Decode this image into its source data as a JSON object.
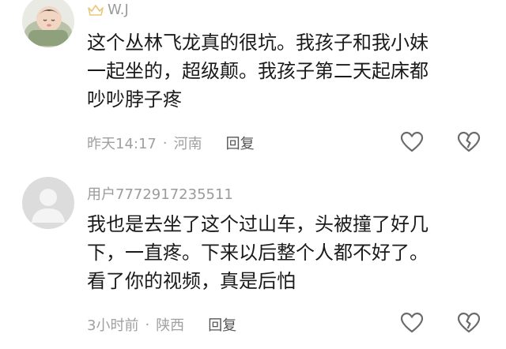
{
  "comments": [
    {
      "username": "W.J",
      "has_crown_badge": true,
      "avatar_icon": "baby-sleeping-avatar",
      "text_lines": [
        "这个丛林飞龙真的很坑。我孩子和我小妹",
        "一起坐的，超级颠。我孩子第二天起床都",
        "吵吵脖子疼"
      ],
      "time": "昨天14:17",
      "separator": "·",
      "location": "河南",
      "reply_label": "回复",
      "like_icon": "heart-outline-icon",
      "dislike_icon": "broken-heart-icon"
    },
    {
      "username": "用户7772917235511",
      "has_crown_badge": false,
      "avatar_icon": "default-user-avatar",
      "text_lines": [
        "我也是去坐了这个过山车，头被撞了好几",
        "下，一直疼。下来以后整个人都不好了。",
        "看了你的视频，真是后怕"
      ],
      "time": "3小时前",
      "separator": "·",
      "location": "陕西",
      "reply_label": "回复",
      "like_icon": "heart-outline-icon",
      "dislike_icon": "broken-heart-icon"
    }
  ],
  "colors": {
    "text": "#1a1a1a",
    "meta": "#a0a0a0",
    "username": "#9b9b9b",
    "crown": "#e8c778",
    "icon": "#6b6b6b"
  }
}
